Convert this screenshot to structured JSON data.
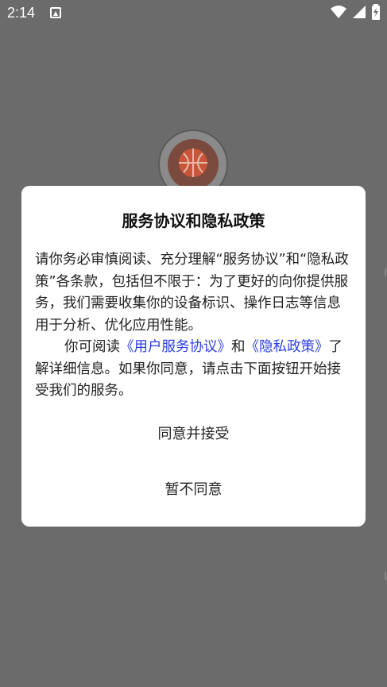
{
  "status_bar": {
    "time": "2:14"
  },
  "dialog": {
    "title": "服务协议和隐私政策",
    "paragraph1": "请你务必审慎阅读、充分理解“服务协议”和“隐私政策”各条款，包括但不限于：为了更好的向你提供服务，我们需要收集你的设备标识、操作日志等信息用于分析、优化应用性能。",
    "paragraph2_prefix": "你可阅读",
    "user_agreement_link": "《用户服务协议》",
    "and_text": "和",
    "privacy_policy_link": "《隐私政策》",
    "paragraph2_suffix": "了解详细信息。如果你同意，请点击下面按钮开始接受我们的服务。",
    "agree_button": "同意并接受",
    "disagree_button": "暂不同意"
  },
  "colors": {
    "overlay": "#6b6b6b",
    "link": "#2b3fe0",
    "dialog_bg": "#ffffff"
  },
  "icons": [
    "app-notification-icon",
    "wifi-icon",
    "signal-icon",
    "battery-icon"
  ]
}
